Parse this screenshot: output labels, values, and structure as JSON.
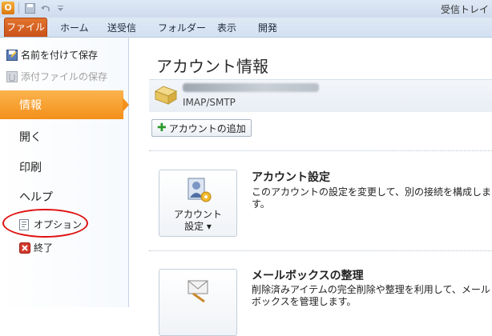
{
  "window": {
    "title": "受信トレイ"
  },
  "qat": {
    "app_icon_letter": "O"
  },
  "tabs": [
    {
      "label": "ファイル",
      "active": true
    },
    {
      "label": "ホーム"
    },
    {
      "label": "送受信"
    },
    {
      "label": "フォルダー"
    },
    {
      "label": "表示"
    },
    {
      "label": "開発"
    }
  ],
  "leftnav": {
    "save_as": "名前を付けて保存",
    "save_attachments": "添付ファイルの保存",
    "info": "情報",
    "open": "開く",
    "print": "印刷",
    "help": "ヘルプ",
    "options": "オプション",
    "exit": "終了"
  },
  "main": {
    "title": "アカウント情報",
    "account_type": "IMAP/SMTP",
    "add_account": "アカウントの追加",
    "account_settings": {
      "button_line1": "アカウント",
      "button_line2": "設定 ▾",
      "heading": "アカウント設定",
      "description": "このアカウントの設定を変更して、別の接続を構成します。"
    },
    "mailbox_cleanup": {
      "heading": "メールボックスの整理",
      "description": "削除済みアイテムの完全削除や整理を利用して、メールボックスを管理します。"
    }
  },
  "colors": {
    "file_tab": "#c9521a",
    "selected_nav": "#f4901b",
    "highlight_ellipse": "#e01010"
  }
}
